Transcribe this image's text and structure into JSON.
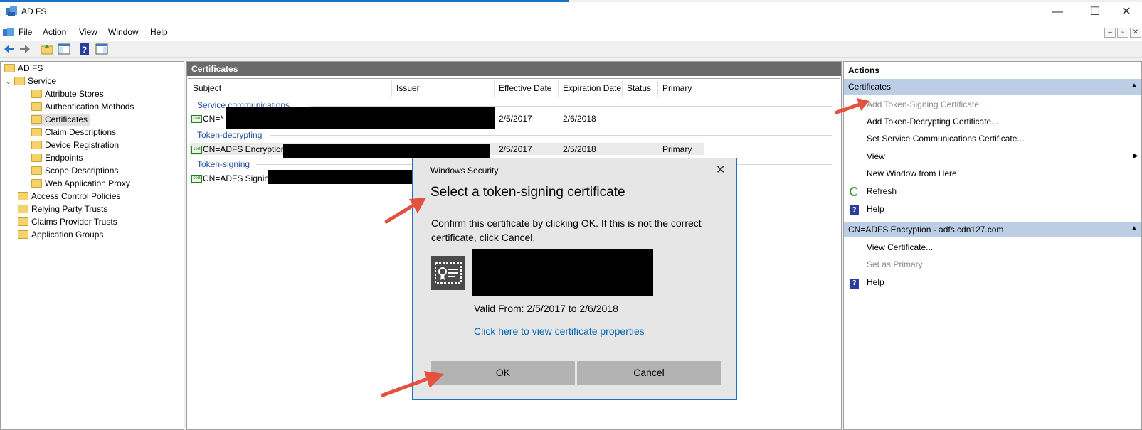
{
  "window": {
    "title": "AD FS",
    "minimize": "—",
    "maximize": "☐",
    "close": "✕"
  },
  "menu": [
    "File",
    "Action",
    "View",
    "Window",
    "Help"
  ],
  "mdi_buttons": [
    "–",
    "▫",
    "✕"
  ],
  "tree": {
    "root": "AD FS",
    "service": "Service",
    "service_children": [
      "Attribute Stores",
      "Authentication Methods",
      "Certificates",
      "Claim Descriptions",
      "Device Registration",
      "Endpoints",
      "Scope Descriptions",
      "Web Application Proxy"
    ],
    "top_items": [
      "Access Control Policies",
      "Relying Party Trusts",
      "Claims Provider Trusts",
      "Application Groups"
    ]
  },
  "center": {
    "title": "Certificates",
    "columns": [
      "Subject",
      "Issuer",
      "Effective Date",
      "Expiration Date",
      "Status",
      "Primary"
    ],
    "groups": [
      {
        "name": "Service communications",
        "row": {
          "subject": "CN=*",
          "effective": "2/5/2017",
          "expiration": "2/6/2018",
          "primary": ""
        }
      },
      {
        "name": "Token-decrypting",
        "row": {
          "subject": "CN=ADFS Encryption -",
          "effective": "2/5/2017",
          "expiration": "2/5/2018",
          "primary": "Primary"
        }
      },
      {
        "name": "Token-signing",
        "row": {
          "subject": "CN=ADFS Signing"
        }
      }
    ]
  },
  "actions": {
    "title": "Actions",
    "section1": "Certificates",
    "items1": [
      "Add Token-Signing Certificate...",
      "Add Token-Decrypting Certificate...",
      "Set Service Communications Certificate...",
      "View",
      "New Window from Here",
      "Refresh",
      "Help"
    ],
    "section2": "CN=ADFS Encryption - adfs.cdn127.com",
    "items2": [
      "View Certificate...",
      "Set as Primary",
      "Help"
    ],
    "collapse_glyph": "▲",
    "submenu_glyph": "▶"
  },
  "dialog": {
    "caption": "Windows Security",
    "heading": "Select a token-signing certificate",
    "message": "Confirm this certificate by clicking OK. If this is not the correct certificate, click Cancel.",
    "valid": "Valid From: 2/5/2017 to 2/6/2018",
    "link": "Click here to view certificate properties",
    "ok": "OK",
    "cancel": "Cancel",
    "close": "✕"
  },
  "colors": {
    "accent": "#1e6fc8",
    "section": "#bccde6",
    "arrow": "#e5513f",
    "link": "#0066b4"
  }
}
